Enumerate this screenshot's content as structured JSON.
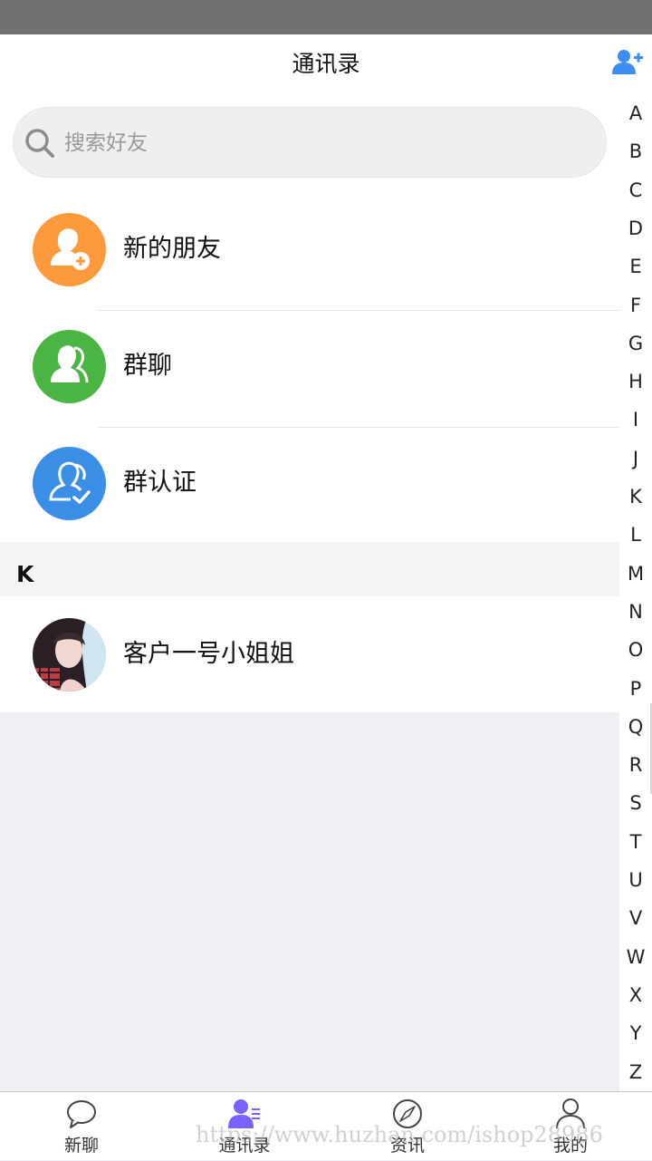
{
  "header": {
    "title": "通讯录",
    "add_icon": "add-user-icon"
  },
  "search": {
    "placeholder": "搜索好友",
    "value": ""
  },
  "menu": [
    {
      "label": "新的朋友",
      "icon": "new-friend-icon",
      "color": "#ff9a3c"
    },
    {
      "label": "群聊",
      "icon": "group-chat-icon",
      "color": "#4bb543"
    },
    {
      "label": "群认证",
      "icon": "group-verify-icon",
      "color": "#3a8ee6"
    }
  ],
  "section": {
    "letter": "K"
  },
  "contacts": [
    {
      "name": "客户一号小姐姐",
      "avatar": "user-avatar-photo"
    }
  ],
  "index_letters": [
    "A",
    "B",
    "C",
    "D",
    "E",
    "F",
    "G",
    "H",
    "I",
    "J",
    "K",
    "L",
    "M",
    "N",
    "O",
    "P",
    "Q",
    "R",
    "S",
    "T",
    "U",
    "V",
    "W",
    "X",
    "Y",
    "Z"
  ],
  "tabs": [
    {
      "label": "新聊",
      "icon": "chat-bubble-icon"
    },
    {
      "label": "通讯录",
      "icon": "contacts-icon",
      "active": true,
      "active_color": "#7b61ff"
    },
    {
      "label": "资讯",
      "icon": "compass-icon"
    },
    {
      "label": "我的",
      "icon": "profile-icon"
    }
  ],
  "watermark": "https://www.huzhan.com/ishop28986"
}
